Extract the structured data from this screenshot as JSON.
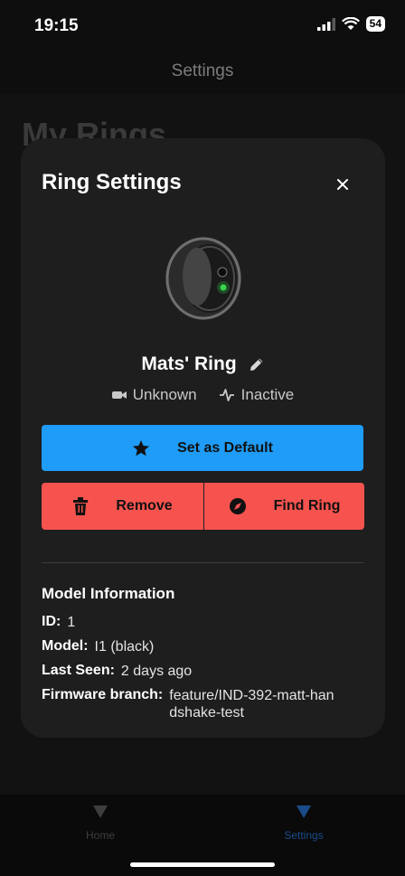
{
  "status_bar": {
    "time": "19:15",
    "battery": "54"
  },
  "nav": {
    "title": "Settings"
  },
  "page": {
    "heading": "My Rings"
  },
  "modal": {
    "title": "Ring Settings",
    "ring_name": "Mats' Ring",
    "connection_status": "Unknown",
    "activity_status": "Inactive",
    "buttons": {
      "set_default": "Set as Default",
      "remove": "Remove",
      "find_ring": "Find Ring"
    },
    "model_info": {
      "title": "Model Information",
      "id_label": "ID:",
      "id_value": "1",
      "model_label": "Model:",
      "model_value": "I1 (black)",
      "last_seen_label": "Last Seen:",
      "last_seen_value": "2 days ago",
      "firmware_label": "Firmware branch:",
      "firmware_value": "feature/IND-392-matt-handshake-test"
    }
  },
  "tabs": [
    {
      "label": "Home",
      "icon": "triangle-down-icon",
      "active": false
    },
    {
      "label": "Settings",
      "icon": "triangle-down-icon",
      "active": true
    }
  ],
  "colors": {
    "primary": "#1f9cf7",
    "danger": "#f6534f",
    "active_tab": "#1a4b8a"
  }
}
